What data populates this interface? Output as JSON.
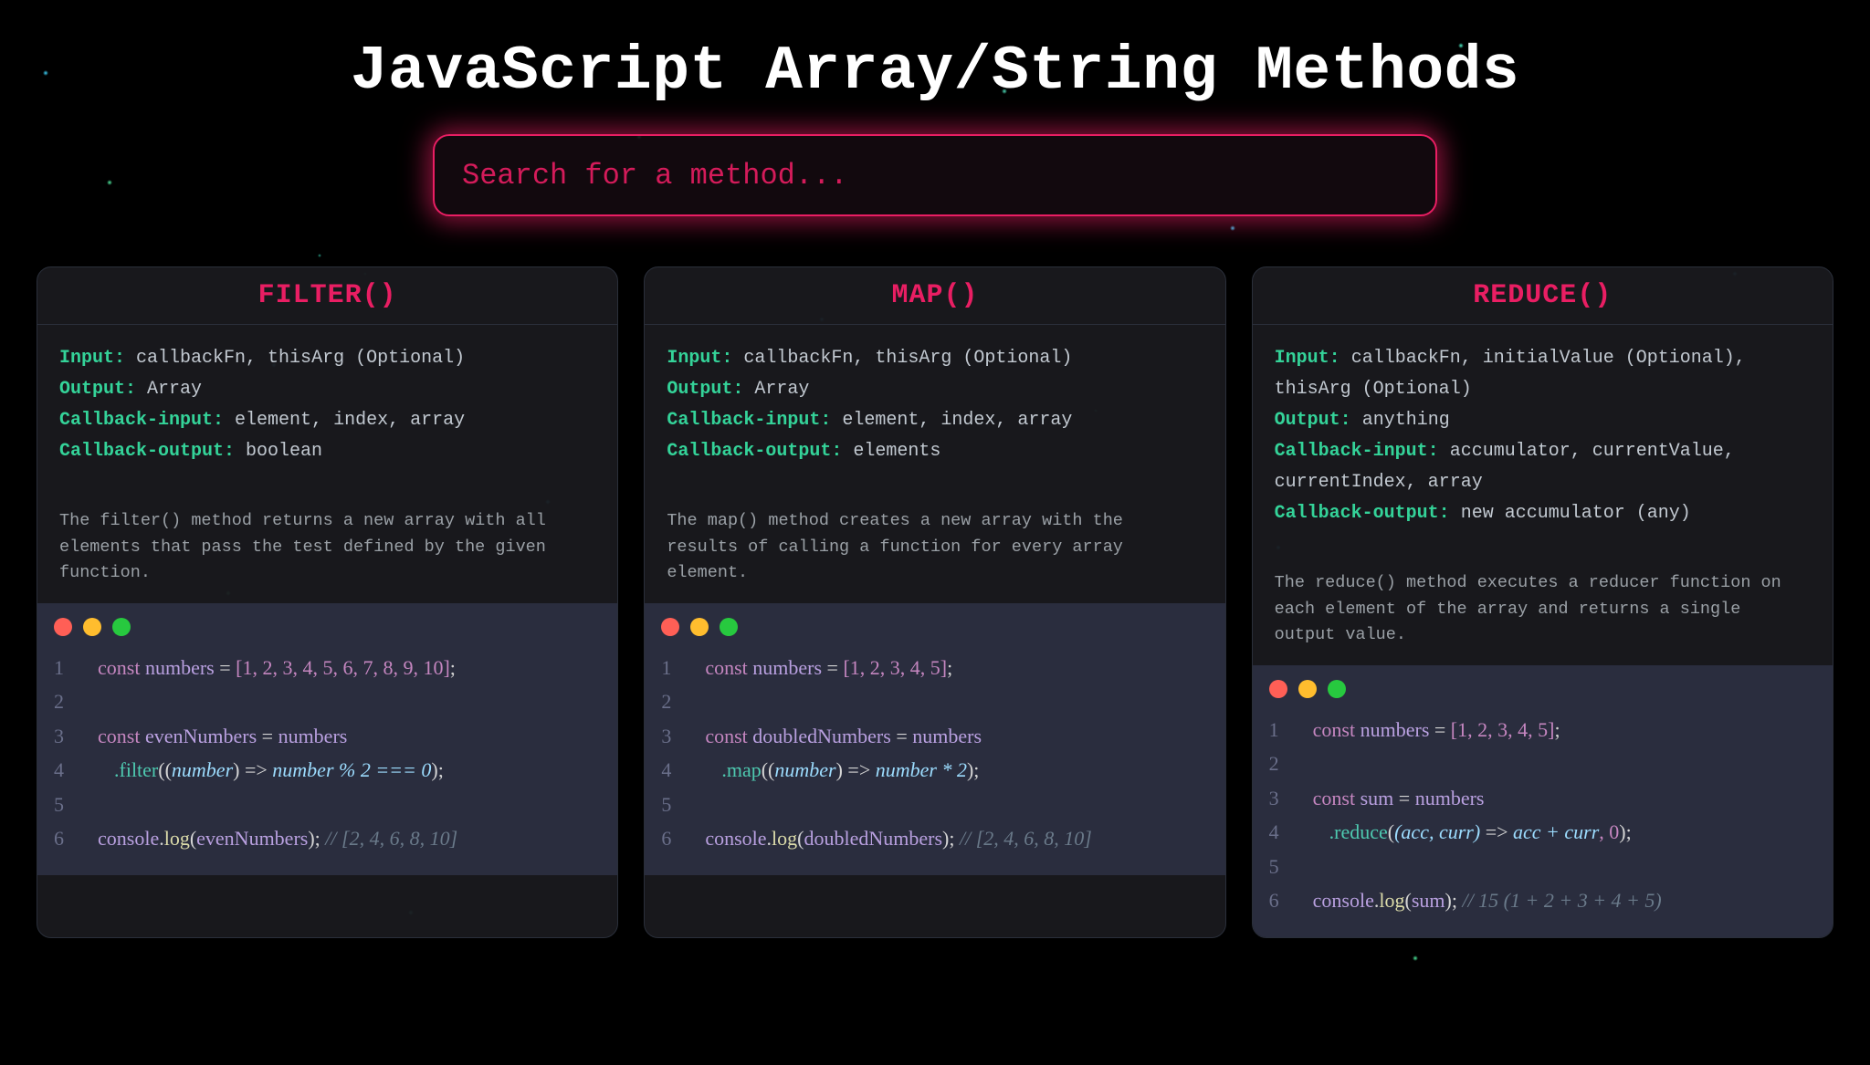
{
  "page": {
    "title": "JavaScript Array/String Methods"
  },
  "search": {
    "placeholder": "Search for a method..."
  },
  "labels": {
    "input": "Input:",
    "output": "Output:",
    "callback_input": "Callback-input:",
    "callback_output": "Callback-output:"
  },
  "cards": [
    {
      "title": "FILTER()",
      "input": "callbackFn, thisArg (Optional)",
      "output": "Array",
      "callback_input": "element, index, array",
      "callback_output": "boolean",
      "description": "The filter() method returns a new array with all elements that pass the test defined by the given function.",
      "code": {
        "line1_array": "[1, 2, 3, 4, 5, 6, 7, 8, 9, 10]",
        "line3_var": "evenNumbers",
        "line4_method": ".filter",
        "line4_param": "number",
        "line4_body": "number % 2 === 0",
        "line6_arg": "evenNumbers",
        "line6_comment": "// [2, 4, 6, 8, 10]"
      }
    },
    {
      "title": "MAP()",
      "input": "callbackFn, thisArg (Optional)",
      "output": "Array",
      "callback_input": "element, index, array",
      "callback_output": "elements",
      "description": "The map() method creates a new array with the results of calling a function for every array element.",
      "code": {
        "line1_array": "[1, 2, 3, 4, 5]",
        "line3_var": "doubledNumbers",
        "line4_method": ".map",
        "line4_param": "number",
        "line4_body": "number * 2",
        "line6_arg": "doubledNumbers",
        "line6_comment": "// [2, 4, 6, 8, 10]"
      }
    },
    {
      "title": "REDUCE()",
      "input": "callbackFn, initialValue (Optional), thisArg (Optional)",
      "output": "anything",
      "callback_input": "accumulator, currentValue, currentIndex, array",
      "callback_output": "new accumulator (any)",
      "description": "The reduce() method executes a reducer function on each element of the array and returns a single output value.",
      "code": {
        "line1_array": "[1, 2, 3, 4, 5]",
        "line3_var": "sum",
        "line4_method": ".reduce",
        "line4_params": "(acc, curr)",
        "line4_body": "acc + curr",
        "line4_init": ", 0",
        "line6_arg": "sum",
        "line6_comment": "// 15 (1 + 2 + 3 + 4 + 5)"
      }
    }
  ]
}
